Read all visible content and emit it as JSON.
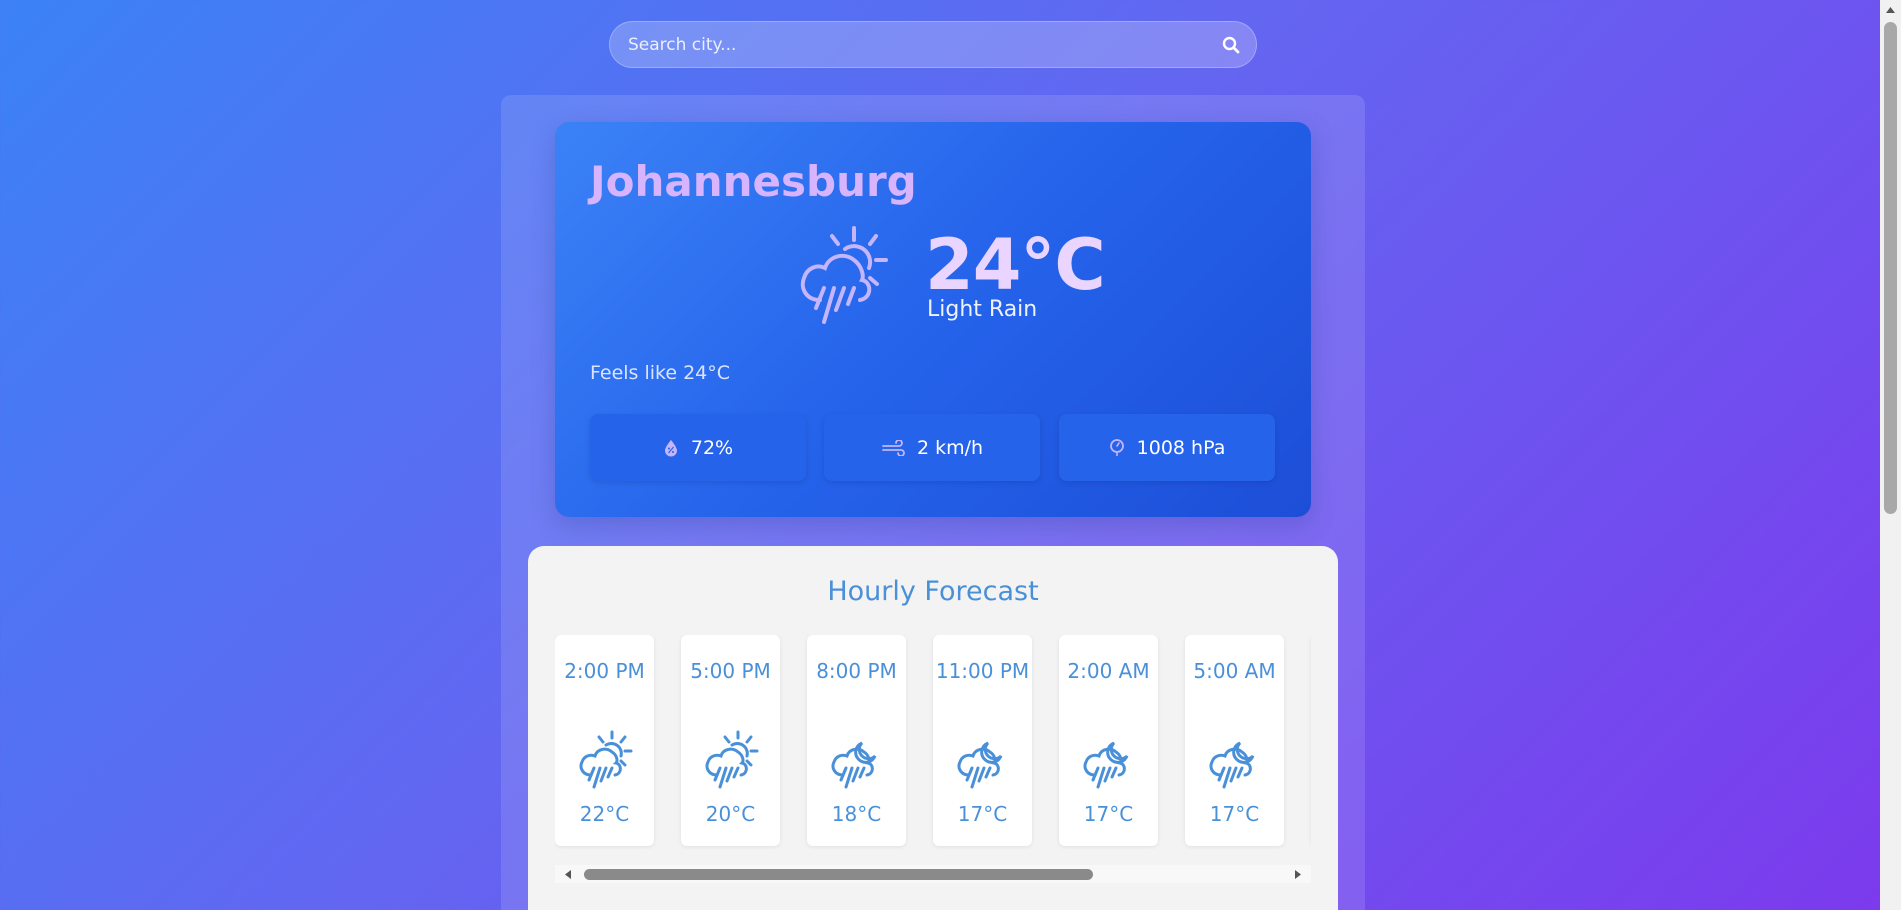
{
  "search": {
    "placeholder": "Search city...",
    "icon": "search-icon"
  },
  "current": {
    "city": "Johannesburg",
    "temperature": "24°C",
    "condition": "Light Rain",
    "feels_like": "Feels like 24°C",
    "icon": "sun-cloud-rain-icon",
    "stats": {
      "humidity": {
        "icon": "humidity-icon",
        "value": "72%"
      },
      "wind": {
        "icon": "wind-icon",
        "value": "2 km/h"
      },
      "pressure": {
        "icon": "pressure-icon",
        "value": "1008 hPa"
      }
    }
  },
  "hourly": {
    "title": "Hourly Forecast",
    "items": [
      {
        "time": "2:00 PM",
        "icon": "sun-cloud-rain-icon",
        "temp": "22°C"
      },
      {
        "time": "5:00 PM",
        "icon": "sun-cloud-rain-icon",
        "temp": "20°C"
      },
      {
        "time": "8:00 PM",
        "icon": "moon-cloud-rain-icon",
        "temp": "18°C"
      },
      {
        "time": "11:00 PM",
        "icon": "moon-cloud-rain-icon",
        "temp": "17°C"
      },
      {
        "time": "2:00 AM",
        "icon": "moon-cloud-rain-icon",
        "temp": "17°C"
      },
      {
        "time": "5:00 AM",
        "icon": "moon-cloud-rain-icon",
        "temp": "17°C"
      }
    ]
  },
  "colors": {
    "accent": "#4a90d9",
    "city": "#d8b4fe",
    "card": "#2563eb"
  }
}
